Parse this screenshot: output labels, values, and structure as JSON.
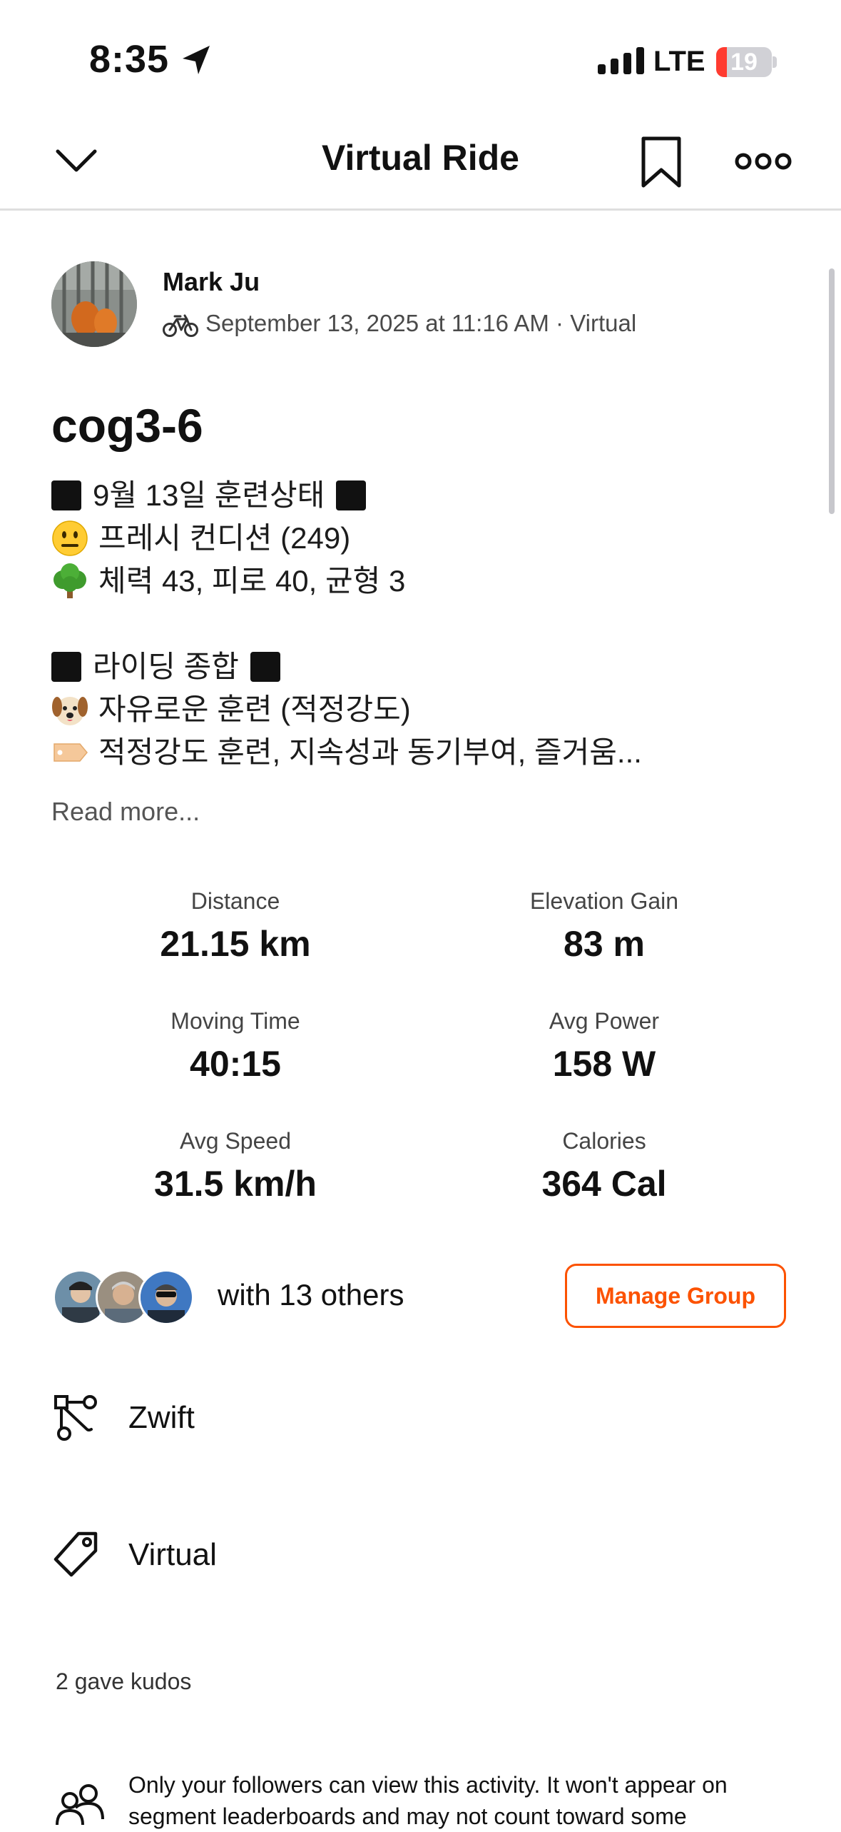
{
  "status_bar": {
    "time": "8:35",
    "network": "LTE",
    "battery": "19",
    "battery_level": 0.19,
    "battery_color": "#ff3b30"
  },
  "nav": {
    "title": "Virtual Ride"
  },
  "author": {
    "name": "Mark Ju",
    "meta": "September 13, 2025 at 11:16 AM · Virtual"
  },
  "activity": {
    "title": "cog3-6",
    "description_lines": [
      "9월 13일 훈련상태",
      "프레시 컨디션 (249)",
      "체력 43, 피로 40, 균형 3",
      "라이딩 종합",
      "자유로운 훈련 (적정강도)",
      "적정강도 훈련, 지속성과 동기부여, 즐거움..."
    ],
    "read_more": "Read more..."
  },
  "stats": [
    {
      "label": "Distance",
      "value": "21.15 km"
    },
    {
      "label": "Elevation Gain",
      "value": "83 m"
    },
    {
      "label": "Moving Time",
      "value": "40:15"
    },
    {
      "label": "Avg Power",
      "value": "158 W"
    },
    {
      "label": "Avg Speed",
      "value": "31.5 km/h"
    },
    {
      "label": "Calories",
      "value": "364 Cal"
    }
  ],
  "group": {
    "with_text": "with 13 others",
    "manage_label": "Manage Group"
  },
  "rows": {
    "device": "Zwift",
    "tag": "Virtual"
  },
  "kudos": "2 gave kudos",
  "privacy": {
    "text": "Only your followers can view this activity. It won't appear on segment leaderboards and may not count toward some"
  },
  "colors": {
    "accent": "#fc5200"
  }
}
